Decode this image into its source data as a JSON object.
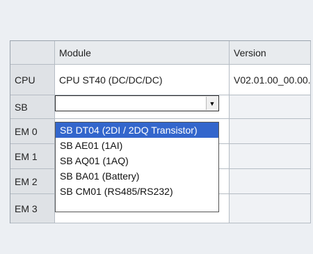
{
  "table": {
    "headers": [
      "",
      "Module",
      "Version"
    ],
    "rows": [
      {
        "label": "CPU",
        "module": "CPU ST40 (DC/DC/DC)",
        "version": "V02.01.00_00.00..."
      },
      {
        "label": "SB",
        "module": "",
        "version": ""
      },
      {
        "label": "EM 0",
        "module": "",
        "version": ""
      },
      {
        "label": "EM 1",
        "module": "",
        "version": ""
      },
      {
        "label": "EM 2",
        "module": "",
        "version": ""
      },
      {
        "label": "EM 3",
        "module": "",
        "version": ""
      }
    ]
  },
  "dropdown": {
    "selected_value": "",
    "options": [
      "SB DT04 (2DI / 2DQ Transistor)",
      "SB AE01 (1AI)",
      "SB AQ01 (1AQ)",
      "SB BA01 (Battery)",
      "SB CM01 (RS485/RS232)"
    ],
    "highlighted_index": 0,
    "arrow": "▼"
  }
}
